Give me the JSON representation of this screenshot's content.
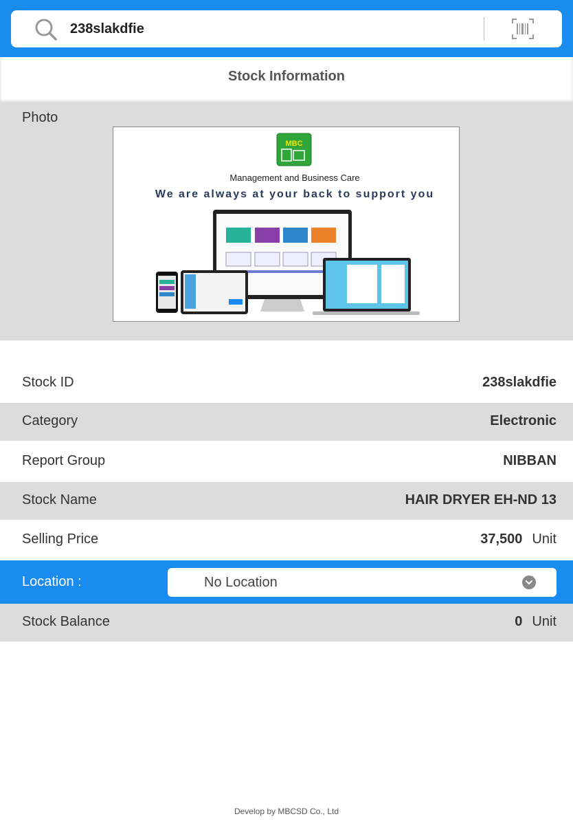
{
  "search": {
    "value": "238slakdfie"
  },
  "page_title": "Stock Information",
  "photo": {
    "label": "Photo",
    "image": {
      "brand": "MBC",
      "company": "Management and Business Care",
      "tagline": "We are always at your back to support you"
    }
  },
  "details": [
    {
      "label": "Stock ID",
      "value": "238slakdfie",
      "unit": ""
    },
    {
      "label": "Category",
      "value": "Electronic",
      "unit": ""
    },
    {
      "label": "Report Group",
      "value": "NIBBAN",
      "unit": ""
    },
    {
      "label": "Stock Name",
      "value": "HAIR DRYER EH-ND 13",
      "unit": ""
    },
    {
      "label": "Selling Price",
      "value": "37,500",
      "unit": "Unit"
    }
  ],
  "location": {
    "label": "Location :",
    "selected": "No Location"
  },
  "stock_balance": {
    "label": "Stock Balance",
    "value": "0",
    "unit": "Unit"
  },
  "footer": "Develop by MBCSD Co., Ltd",
  "colors": {
    "accent": "#1a8cf0",
    "row_gray": "#dcdcdc"
  }
}
